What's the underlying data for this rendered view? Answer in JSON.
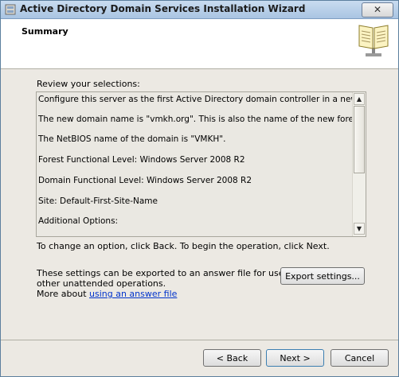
{
  "window": {
    "title": "Active Directory Domain Services Installation Wizard",
    "close_glyph": "✕"
  },
  "header": {
    "title": "Summary",
    "icon": "book-icon"
  },
  "review_label": "Review your selections:",
  "selections": [
    "Configure this server as the first Active Directory domain controller in a new forest.",
    "The new domain name is \"vmkh.org\". This is also the name of the new forest.",
    "The NetBIOS name of the domain is \"VMKH\".",
    "Forest Functional Level: Windows Server 2008 R2",
    "Domain Functional Level: Windows Server 2008 R2",
    "Site: Default-First-Site-Name",
    "Additional Options:"
  ],
  "scroll": {
    "up_glyph": "▲",
    "down_glyph": "▼"
  },
  "change_hint": "To change an option, click Back. To begin the operation, click Next.",
  "export": {
    "text_line1": "These settings can be exported to an answer file for use with",
    "text_line2": "other unattended operations.",
    "more_prefix": "More about ",
    "more_link": "using an answer file",
    "button": "Export settings..."
  },
  "footer": {
    "back": "< Back",
    "next": "Next >",
    "cancel": "Cancel"
  }
}
